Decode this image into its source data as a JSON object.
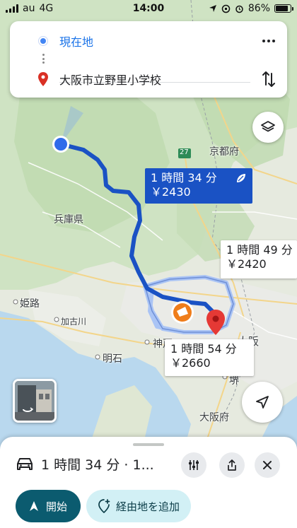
{
  "status_bar": {
    "carrier": "au",
    "network": "4G",
    "time": "14:00",
    "battery": "86%",
    "battery_level": 0.86
  },
  "search": {
    "origin": "現在地",
    "destination": "大阪市立野里小学校"
  },
  "map_labels": {
    "hyogo": "兵庫県",
    "kyoto": "京都府",
    "himeji": "姫路",
    "kakogawa": "加古川",
    "akashi": "明石",
    "kobe": "神戸",
    "osaka": "大阪",
    "osaka_pref": "大阪府",
    "sakai": "堺",
    "road_27": "27"
  },
  "routes": {
    "primary": {
      "time": "1 時間 34 分",
      "toll": "￥2430"
    },
    "alt1": {
      "time": "1 時間 49 分",
      "toll": "￥2420"
    },
    "alt2": {
      "time": "1 時間 54 分",
      "toll": "￥2660"
    }
  },
  "sheet": {
    "summary": "1 時間 34 分 · 1...",
    "start_label": "開始",
    "add_stop_label": "経由地を追加"
  },
  "colors": {
    "route_primary": "#1a52c4",
    "route_alt": "#aac4f5",
    "start_button": "#0b5b6f"
  }
}
